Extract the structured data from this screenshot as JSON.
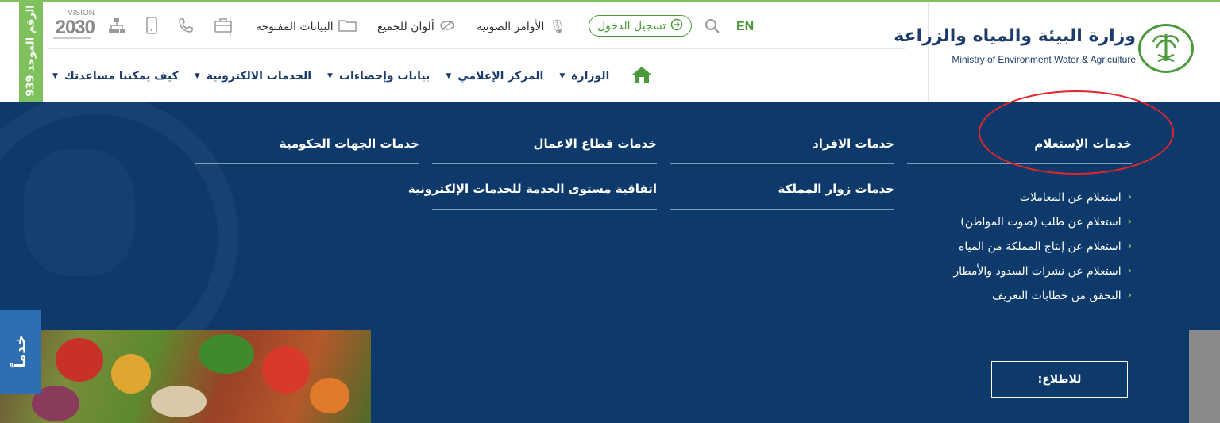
{
  "header": {
    "ministry_ar": "وزارة البيئة والمياه والزراعة",
    "ministry_en": "Ministry of Environment Water & Agriculture",
    "lang": "EN",
    "login": "تسجيل الدخول",
    "voice_commands": "الأوامر الصوتية",
    "colors_for_all": "ألوان للجميع",
    "open_data": "البيانات المفتوحة",
    "vision_top": "VISION",
    "vision_year": "2030",
    "unified_number": "الرقم الموحد 939",
    "icons": [
      "search-icon",
      "login-icon",
      "mic-icon",
      "eye-slash-icon",
      "folder-icon",
      "briefcase-icon",
      "phone-icon",
      "mobile-icon",
      "sitemap-icon",
      "home-icon"
    ]
  },
  "nav": {
    "items": [
      {
        "label": "الوزارة"
      },
      {
        "label": "المركز الإعلامي"
      },
      {
        "label": "بيانات وإحصاءات"
      },
      {
        "label": "الخدمات الالكترونية"
      },
      {
        "label": "كيف يمكننا مساعدتك"
      }
    ]
  },
  "mega": {
    "inquiry": {
      "title": "خدمات الإستعلام",
      "items": [
        "استعلام عن المعاملات",
        "استعلام عن طلب (صوت المواطن)",
        "استعلام عن إنتاج المملكة من المياه",
        "استعلام عن نشرات السدود والأمطار",
        "التحقق من خطابات التعريف"
      ]
    },
    "individuals": "خدمات الافراد",
    "visitors": "خدمات زوار المملكة",
    "business": "خدمات قطاع الاعمال",
    "sla": "اتفاقية مستوى الخدمة للخدمات الإلكترونية",
    "government": "خدمات الجهات الحكومية"
  },
  "bottom": {
    "view_button": "للاطلاع:",
    "side_tab": "خدماً"
  },
  "colors": {
    "green": "#7fc15c",
    "navy": "#0d3a6b",
    "annotation": "#e0262b"
  }
}
